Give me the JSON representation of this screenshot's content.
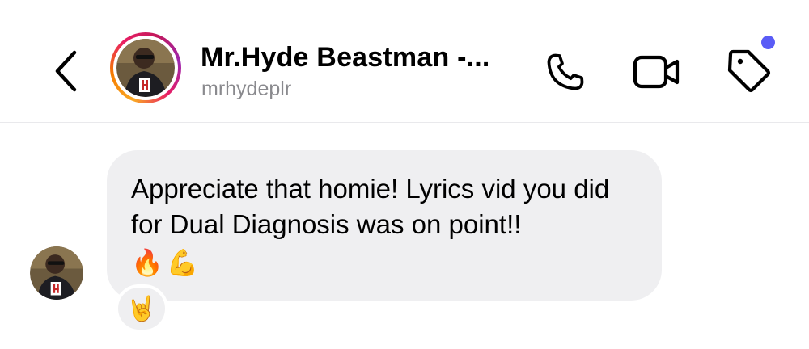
{
  "header": {
    "name": "Mr.Hyde Beastman -...",
    "handle": "mrhydeplr",
    "icons": {
      "back": "chevron-left-icon",
      "call": "phone-icon",
      "video": "video-camera-icon",
      "tag": "tag-icon"
    },
    "notification_dot_color": "#5a5cf6"
  },
  "message": {
    "text": "Appreciate that homie! Lyrics vid you did for Dual Diagnosis was on point!!",
    "emojis": "🔥💪",
    "reaction": "🤘",
    "bubble_color": "#efeff1"
  },
  "colors": {
    "story_ring": [
      "#f9a825",
      "#e91e63",
      "#9c27b0"
    ],
    "handle_text": "#8a8a8e"
  }
}
